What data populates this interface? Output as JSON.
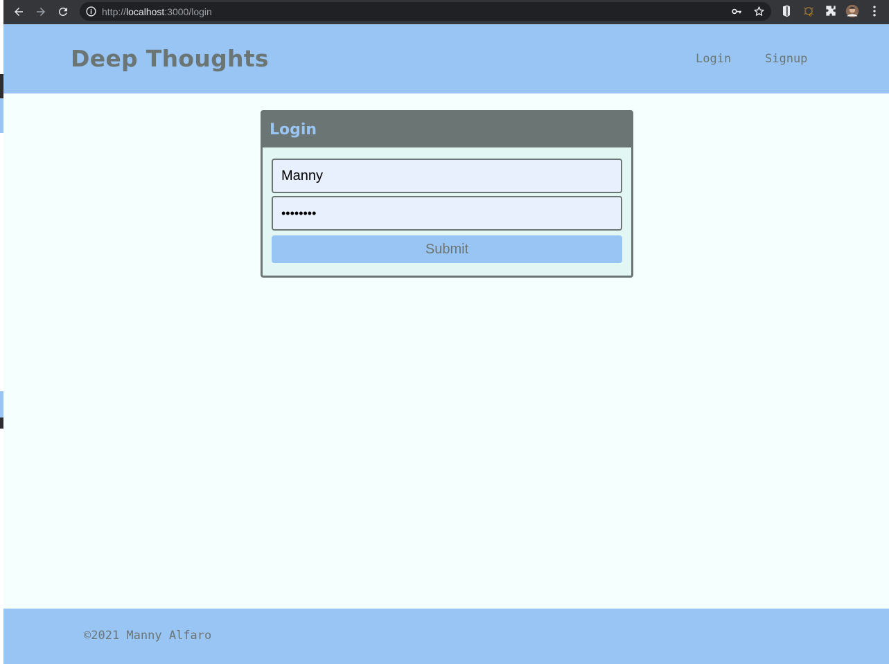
{
  "browser": {
    "url_scheme": "http://",
    "url_host": "localhost",
    "url_path": ":3000/login"
  },
  "header": {
    "brand": "Deep Thoughts",
    "nav": [
      {
        "label": "Login"
      },
      {
        "label": "Signup"
      }
    ]
  },
  "login_form": {
    "title": "Login",
    "username_value": "Manny",
    "password_value": "••••••••",
    "submit_label": "Submit"
  },
  "footer": {
    "text": "©2021 Manny Alfaro"
  },
  "colors": {
    "header_bg": "#99c5f5",
    "text_gray": "#6b7574",
    "page_bg": "#f5fffe",
    "card_bg": "#e2f6f3",
    "input_bg": "#e8f0fe"
  }
}
